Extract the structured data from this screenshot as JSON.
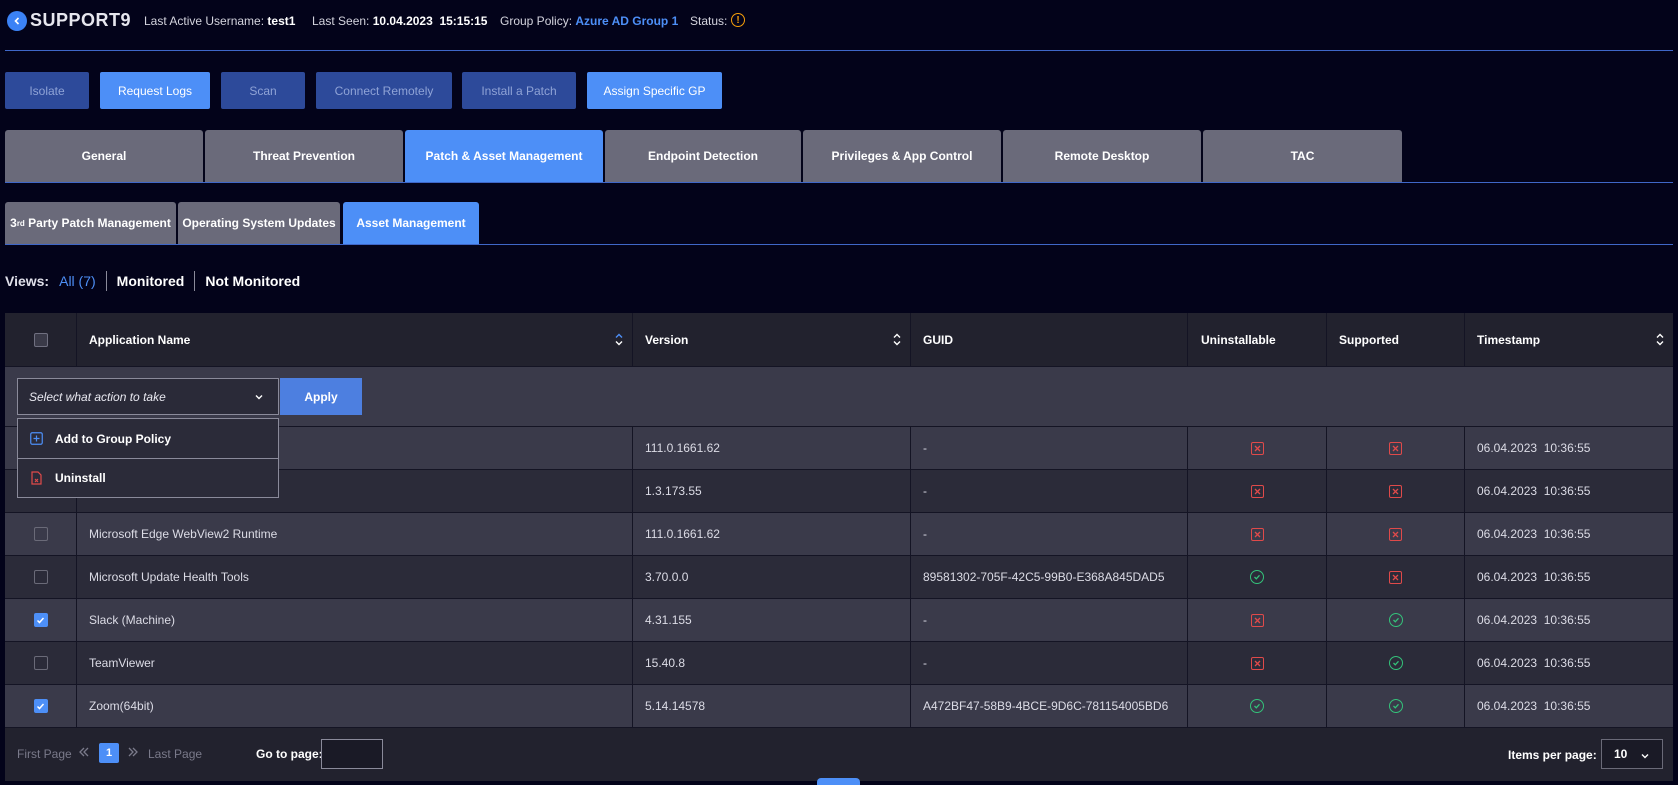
{
  "header": {
    "brand": "SUPPORT9",
    "last_active_label": "Last Active Username:",
    "last_active_value": "test1",
    "last_seen_label": "Last Seen:",
    "last_seen_value": "10.04.2023  15:15:15",
    "group_policy_label": "Group Policy:",
    "group_policy_value": "Azure AD Group 1",
    "status_label": "Status:"
  },
  "actions": [
    "Isolate",
    "Request Logs",
    "Scan",
    "Connect Remotely",
    "Install a Patch",
    "Assign Specific GP"
  ],
  "tabs": [
    "General",
    "Threat Prevention",
    "Patch & Asset Management",
    "Endpoint Detection",
    "Privileges & App Control",
    "Remote Desktop",
    "TAC"
  ],
  "subtabs": {
    "third_party_prefix": "3",
    "third_party_sup": "rd",
    "third_party_rest": " Party Patch Management",
    "os": "Operating System Updates",
    "asset": "Asset Management"
  },
  "views": {
    "label": "Views:",
    "all": "All (7)",
    "monitored": "Monitored",
    "not_monitored": "Not Monitored"
  },
  "table": {
    "headers": [
      "Application Name",
      "Version",
      "GUID",
      "Uninstallable",
      "Supported",
      "Timestamp"
    ],
    "action_placeholder": "Select what action to take",
    "apply_label": "Apply",
    "rows": [
      {
        "name": "",
        "version": "111.0.1661.62",
        "guid": "-",
        "uninstallable": "no",
        "supported": "no",
        "timestamp": "06.04.2023  10:36:55",
        "checked": false
      },
      {
        "name": "",
        "version": "1.3.173.55",
        "guid": "-",
        "uninstallable": "no",
        "supported": "no",
        "timestamp": "06.04.2023  10:36:55",
        "checked": false
      },
      {
        "name": "Microsoft Edge WebView2 Runtime",
        "version": "111.0.1661.62",
        "guid": "-",
        "uninstallable": "no",
        "supported": "no",
        "timestamp": "06.04.2023  10:36:55",
        "checked": false
      },
      {
        "name": "Microsoft Update Health Tools",
        "version": "3.70.0.0",
        "guid": "89581302-705F-42C5-99B0-E368A845DAD5",
        "uninstallable": "yes",
        "supported": "no",
        "timestamp": "06.04.2023  10:36:55",
        "checked": false
      },
      {
        "name": "Slack (Machine)",
        "version": "4.31.155",
        "guid": "-",
        "uninstallable": "no",
        "supported": "yes",
        "timestamp": "06.04.2023  10:36:55",
        "checked": true
      },
      {
        "name": "TeamViewer",
        "version": "15.40.8",
        "guid": "-",
        "uninstallable": "no",
        "supported": "yes",
        "timestamp": "06.04.2023  10:36:55",
        "checked": false
      },
      {
        "name": "Zoom(64bit)",
        "version": "5.14.14578",
        "guid": "A472BF47-58B9-4BCE-9D6C-781154005BD6",
        "uninstallable": "yes",
        "supported": "yes",
        "timestamp": "06.04.2023  10:36:55",
        "checked": true
      }
    ]
  },
  "dropdown": {
    "items": [
      "Add to Group Policy",
      "Uninstall"
    ]
  },
  "footer": {
    "first_page": "First Page",
    "last_page": "Last Page",
    "current_page": "1",
    "goto_label": "Go to page:",
    "items_per_page_label": "Items per page:",
    "items_per_page_value": "10"
  },
  "colors": {
    "accent": "#4d8ff7",
    "error": "#e04a4a",
    "success": "#34c27a",
    "warning": "#f59e0b"
  }
}
